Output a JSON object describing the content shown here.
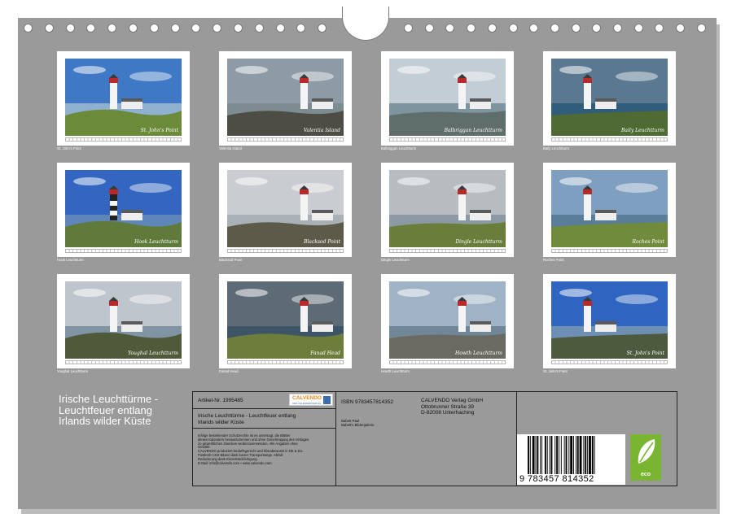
{
  "calendar_title_lines": [
    "Irische Leuchttürme -",
    "Leuchtfeuer entlang",
    "Irlands wilder Küste"
  ],
  "photos": [
    {
      "caption": "St. John's Point",
      "signature": "St. John's Point",
      "sky": "#3f78c4",
      "ground": "#6b8a3a",
      "sea": "#8fb0cf"
    },
    {
      "caption": "Valentia Island",
      "signature": "Valentia Island",
      "sky": "#8d9ba6",
      "ground": "#4d4d45",
      "sea": "#7d8c90"
    },
    {
      "caption": "Balbriggan Leuchtturm",
      "signature": "Balbriggan Leuchtturm",
      "sky": "#c3cdd6",
      "ground": "#5f6e6b",
      "sea": "#7e95a0"
    },
    {
      "caption": "Baily Leuchtturm",
      "signature": "Baily Leuchtturm",
      "sky": "#5a7890",
      "ground": "#4f6b33",
      "sea": "#2f5d7a"
    },
    {
      "caption": "Hook Leuchtturm",
      "signature": "Hook Leuchtturm",
      "sky": "#3366c0",
      "ground": "#5f7a3a",
      "sea": "#5e86b8"
    },
    {
      "caption": "Blacksod Point",
      "signature": "Blacksod Point",
      "sky": "#c9ccd0",
      "ground": "#5e5a4a",
      "sea": "#a9b0b6"
    },
    {
      "caption": "Dingle Leuchtturm",
      "signature": "Dingle Leuchtturm",
      "sky": "#b7bcc0",
      "ground": "#6a7d3a",
      "sea": "#8b9aa2"
    },
    {
      "caption": "Roches Point",
      "signature": "Roches Point",
      "sky": "#7f9fc0",
      "ground": "#6f8b3b",
      "sea": "#5a7d99"
    },
    {
      "caption": "Youghal Leuchtturm",
      "signature": "Youghal Leuchtturm",
      "sky": "#bfc5cc",
      "ground": "#4f5a3a",
      "sea": "#8194a3"
    },
    {
      "caption": "Fanad Head",
      "signature": "Fanad Head",
      "sky": "#5d6b76",
      "ground": "#6d7d3c",
      "sea": "#3e5568"
    },
    {
      "caption": "Howth Leuchtturm",
      "signature": "Howth Leuchtturm",
      "sky": "#9fb2c6",
      "ground": "#6a6a62",
      "sea": "#6f8797"
    },
    {
      "caption": "St. John's Point",
      "signature": "St. John's Point",
      "sky": "#2f64c0",
      "ground": "#4e5a3d",
      "sea": "#6e8fb4"
    }
  ],
  "info": {
    "article": "Artikel-Nr. 1995485",
    "product_lines": [
      "Irische Leuchttürme - Leuchtfeuer entlang",
      "Irlands wilder Küste"
    ],
    "isbn": "ISBN 9783457814352",
    "publisher_lines": [
      "CALVENDO Verlag GmbH",
      "Ottobrunner Straße 39",
      "D-82008 Unterhaching"
    ],
    "author_lines": [
      "Babett Paul",
      "Babett's Bildergalerie"
    ],
    "legal_lines": [
      "Infolge bestehender Schutzrechte ist es untersagt, die Blätter",
      "dieses Kalenders herauszutrennen und ohne Genehmigung des Verlages",
      "zu gewerblichen Zwecken weiterzuverwenden. Alle Angaben ohne",
      "Gewähr.",
      "CALVENDO produziert bedarfsgerecht und klimabewusst in DE & EU.",
      "Postkorb CO2-Bilanz dank kurzer Transportwege. Abfall-",
      "Reduzierung dank Einzelstückfertigung.",
      "E-Mail: info@calvendo.com • www.calvendo.com"
    ],
    "logo_text": "CALVENDO",
    "logo_sub": "DER KALENDERVERLAG",
    "barcode_digits": "9  783457  814352",
    "eco_label": "eco"
  },
  "colors": {
    "sheet": "#9a9a9a",
    "eco": "#79b531",
    "logo_orange": "#e8891c",
    "logo_blue": "#3a6db0"
  }
}
